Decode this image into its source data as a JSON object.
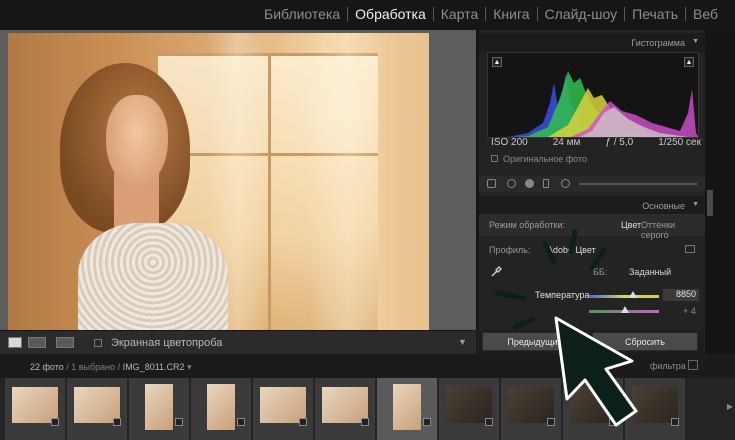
{
  "modules": [
    "Библиотека",
    "Обработка",
    "Карта",
    "Книга",
    "Слайд-шоу",
    "Печать",
    "Веб"
  ],
  "active_module": "Обработка",
  "toolbar": {
    "softproof_label": "Экранная цветопроба"
  },
  "histogram_panel": {
    "title": "Гистограмма",
    "iso": "ISO 200",
    "focal": "24 мм",
    "aperture": "ƒ / 5,0",
    "shutter": "1/250 сек",
    "original_label": "Оригинальное фото"
  },
  "basic_panel": {
    "title": "Основные",
    "treatment_label": "Режим обработки:",
    "treatment_color": "Цвет",
    "treatment_bw": "Оттенки серого",
    "profile_label": "Профиль:",
    "profile_value": "Adobe Цвет",
    "wb_label": "ББ:",
    "wb_value": "Заданный",
    "temperature_label": "Температура",
    "temperature_value": "8850",
    "tint_value": "+ 4"
  },
  "buttons": {
    "previous": "Предыдущий",
    "reset": "Сбросить"
  },
  "filmstrip": {
    "count": "22 фото",
    "selected": "1 выбрано",
    "filename": "IMG_8011.CR2",
    "filter_label": "фильтра"
  },
  "colors": {
    "overlay_arrow": "#0d1f1a",
    "overlay_arrow_stroke": "#ffffff",
    "active_module": "#f0f0f0"
  }
}
